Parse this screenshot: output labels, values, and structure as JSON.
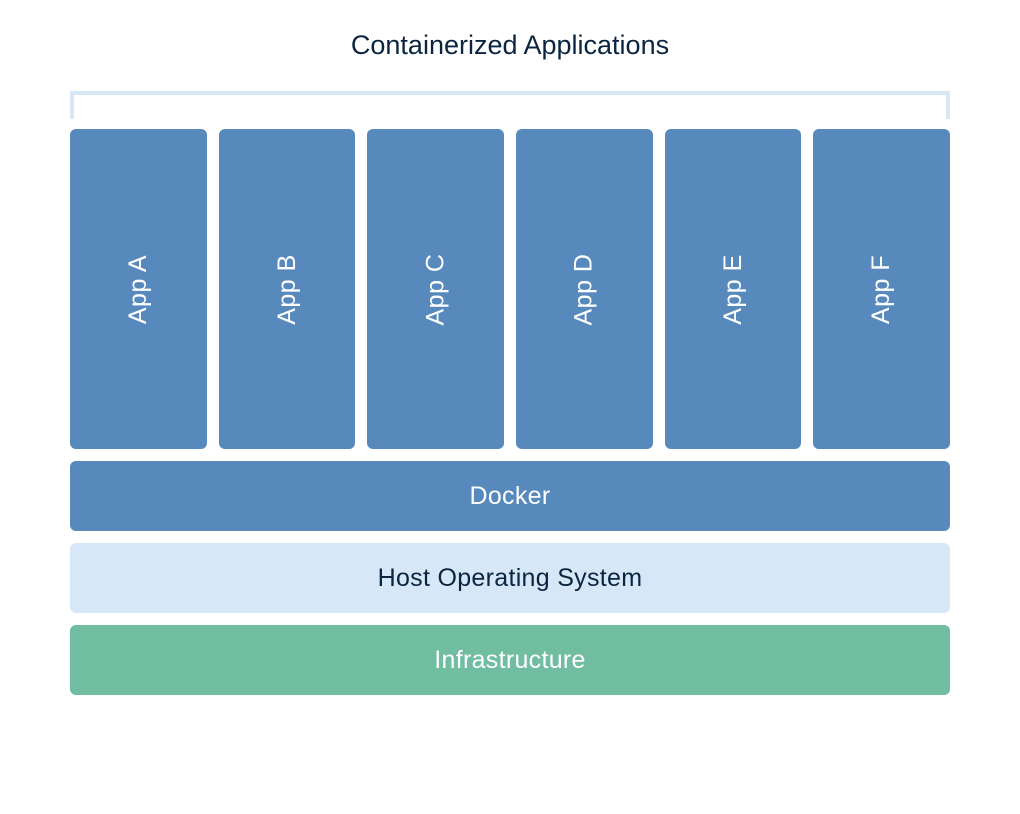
{
  "title": "Containerized Applications",
  "apps": {
    "a": "App A",
    "b": "App B",
    "c": "App C",
    "d": "App D",
    "e": "App E",
    "f": "App F"
  },
  "layers": {
    "docker": "Docker",
    "host": "Host Operating System",
    "infrastructure": "Infrastructure"
  }
}
